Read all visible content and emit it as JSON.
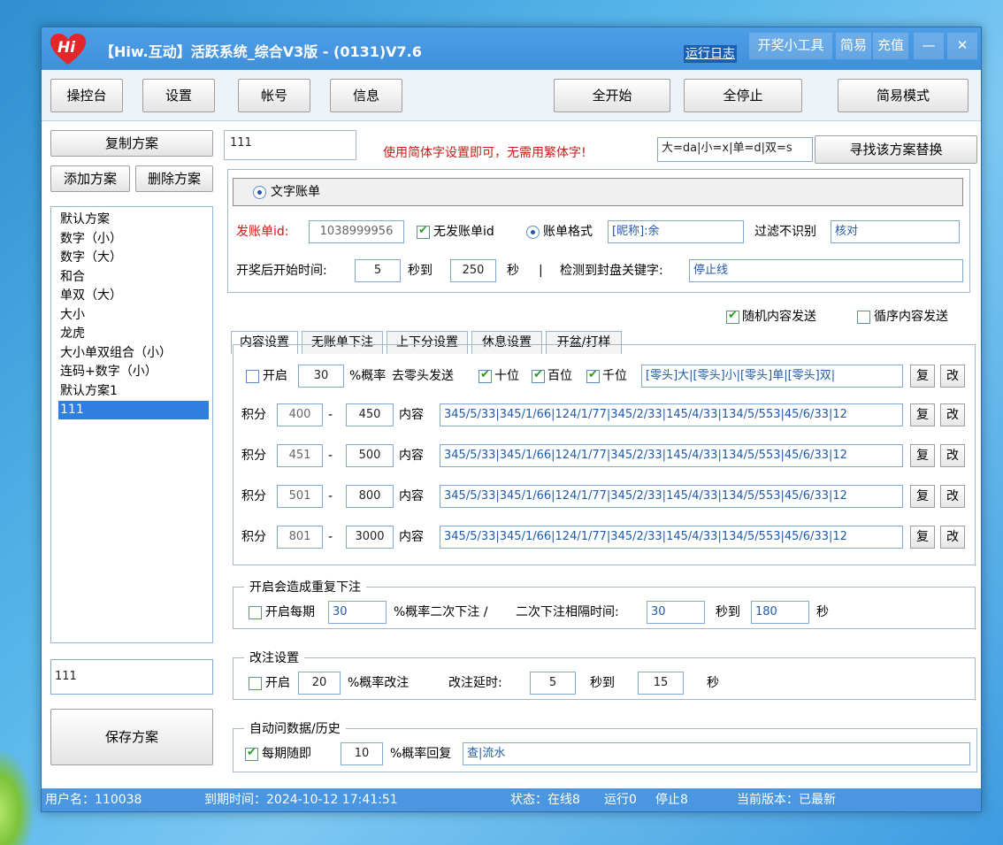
{
  "window": {
    "title": "【Hiw.互动】活跃系统_综合V3版 - (0131)V7.6",
    "logo_text": "Hi",
    "run_log": "运行日志",
    "title_buttons": [
      "开奖小工具",
      "简易",
      "充值"
    ],
    "minimize": "—",
    "close": "✕"
  },
  "toolbar": {
    "console": "操控台",
    "settings": "设置",
    "account": "帐号",
    "info": "信息",
    "start_all": "全开始",
    "stop_all": "全停止",
    "simple_mode": "简易模式"
  },
  "left": {
    "copy_plan": "复制方案",
    "add_plan": "添加方案",
    "delete_plan": "删除方案",
    "plans": [
      "默认方案",
      "数字（小）",
      "数字（大）",
      "和合",
      "单双（大）",
      "大小",
      "龙虎",
      "大小单双组合（小）",
      "连码+数字（小）",
      "默认方案1",
      "111"
    ],
    "selected_index": 10,
    "name_value": "111",
    "save_plan": "保存方案"
  },
  "header": {
    "plan_name": "111",
    "hint": "使用简体字设置即可，无需用繁体字!",
    "replace_rule": "大=da|小=x|单=d|双=s",
    "find_replace": "寻找该方案替换"
  },
  "bill": {
    "radio_label": "文字账单",
    "send_id_label": "发账单id:",
    "send_id_value": "1038999956",
    "no_bill_id_label": "无发账单id",
    "bill_format_label": "账单格式",
    "bill_format_value": "[昵称]:余",
    "filter_label": "过滤不识别",
    "filter_value": "核对",
    "start_after_label": "开奖后开始时间:",
    "start_from": "5",
    "sec_to": "秒到",
    "start_to": "250",
    "sec": "秒",
    "sep": "|",
    "close_keyword_label": "检测到封盘关键字:",
    "close_keyword_value": "停止线"
  },
  "tabs": [
    "内容设置",
    "无账单下注",
    "上下分设置",
    "休息设置",
    "开盆/打样"
  ],
  "send_options": {
    "random_label": "随机内容发送",
    "random_checked": true,
    "loop_label": "循序内容发送",
    "loop_checked": false
  },
  "content": {
    "enable_label": "开启",
    "enable_checked": false,
    "rate_value": "30",
    "rate_label": "%概率",
    "strip_label": "去零头发送",
    "digits": [
      {
        "label": "十位",
        "checked": true
      },
      {
        "label": "百位",
        "checked": true
      },
      {
        "label": "千位",
        "checked": true
      }
    ],
    "first_content": "[零头]大|[零头]小|[零头]单|[零头]双|",
    "copy_btn": "复",
    "edit_btn": "改",
    "score_label": "积分",
    "dash": "-",
    "content_label": "内容",
    "rows": [
      {
        "from": "400",
        "to": "450",
        "content": "345/5/33|345/1/66|124/1/77|345/2/33|145/4/33|134/5/553|45/6/33|12"
      },
      {
        "from": "451",
        "to": "500",
        "content": "345/5/33|345/1/66|124/1/77|345/2/33|145/4/33|134/5/553|45/6/33|12"
      },
      {
        "from": "501",
        "to": "800",
        "content": "345/5/33|345/1/66|124/1/77|345/2/33|145/4/33|134/5/553|45/6/33|12"
      },
      {
        "from": "801",
        "to": "3000",
        "content": "345/5/33|345/1/66|124/1/77|345/2/33|145/4/33|134/5/553|45/6/33|12"
      }
    ]
  },
  "repeat": {
    "group_title": "开启会造成重复下注",
    "enable_label": "开启每期",
    "enable_checked": false,
    "rate_value": "30",
    "rate_label": "%概率二次下注  /",
    "interval_label": "二次下注相隔时间:",
    "from": "30",
    "sec_to": "秒到",
    "to": "180",
    "sec": "秒"
  },
  "modify": {
    "group_title": "改注设置",
    "enable_label": "开启",
    "enable_checked": false,
    "rate_value": "20",
    "rate_label": "%概率改注",
    "delay_label": "改注延时:",
    "from": "5",
    "sec_to": "秒到",
    "to": "15",
    "sec": "秒"
  },
  "auto_ask": {
    "group_title": "自动问数据/历史",
    "enable_label": "每期随即",
    "enable_checked": true,
    "rate_value": "10",
    "rate_label": "%概率回复",
    "reply_value": "查|流水"
  },
  "status": {
    "username": "用户名：110038",
    "expire": "到期时间：2024-10-12 17:41:51",
    "state": "状态：在线8",
    "running": "运行0",
    "stopped": "停止8",
    "version": "当前版本：已最新"
  },
  "colors": {
    "titlebar": "#4e9ee6",
    "statusbar": "#4a96e0",
    "selection": "#2f7ee0",
    "hint_red": "#d21818",
    "input_text_blue": "#1f5aa8"
  }
}
